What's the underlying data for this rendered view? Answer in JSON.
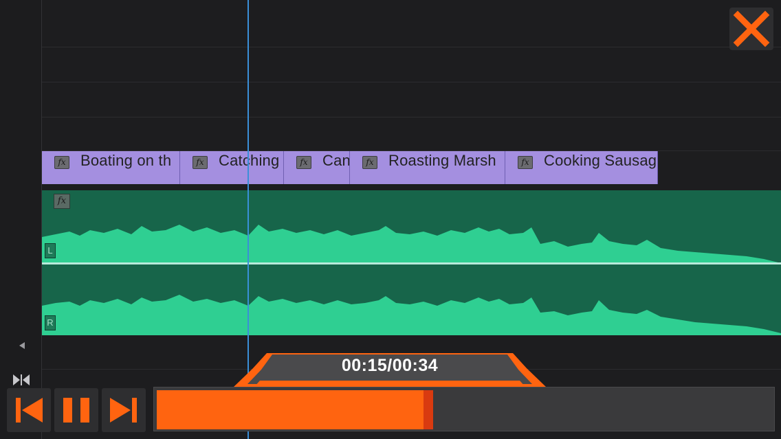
{
  "timeline": {
    "video_clips": [
      {
        "label": "Boating on th",
        "fx": "fx"
      },
      {
        "label": "Catching",
        "fx": "fx"
      },
      {
        "label": "Can",
        "fx": "fx"
      },
      {
        "label": "Roasting Marsh",
        "fx": "fx"
      },
      {
        "label": "Cooking Sausag",
        "fx": "fx"
      }
    ],
    "audio_clip": {
      "fx": "fx",
      "channel_left": "L",
      "channel_right": "R"
    }
  },
  "player": {
    "time_display": "00:15/00:34",
    "progress_fraction": 0.45,
    "accent_color": "#ff6410",
    "close_icon": "close-icon",
    "controls": [
      "skip-back-icon",
      "pause-icon",
      "skip-forward-icon"
    ]
  }
}
